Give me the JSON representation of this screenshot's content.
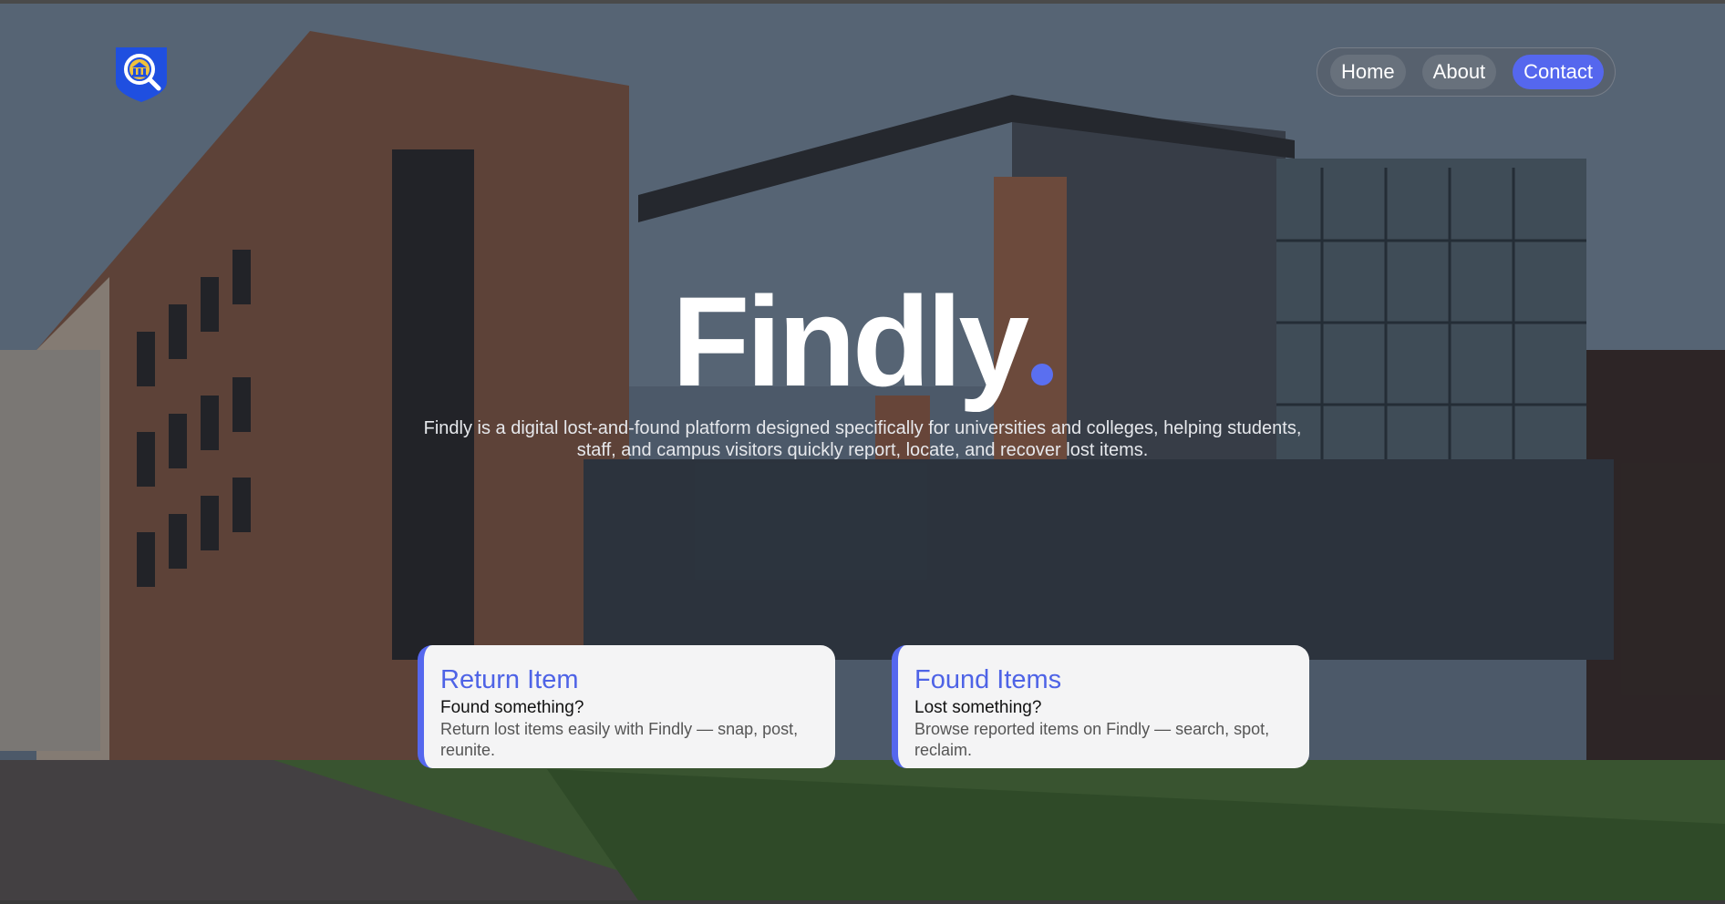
{
  "nav": {
    "items": [
      {
        "label": "Home",
        "active": false
      },
      {
        "label": "About",
        "active": false
      },
      {
        "label": "Contact",
        "active": true
      }
    ]
  },
  "hero": {
    "title": "Findly",
    "description": "Findly is a digital lost-and-found platform designed specifically for universities and colleges, helping students, staff, and campus visitors quickly report, locate, and recover lost items."
  },
  "cards": [
    {
      "title": "Return Item",
      "subtitle": "Found something?",
      "description": "Return lost items easily with Findly — snap, post, reunite."
    },
    {
      "title": "Found Items",
      "subtitle": "Lost something?",
      "description": "Browse reported items on Findly — search, spot, reclaim."
    }
  ],
  "colors": {
    "accent": "#5567ee",
    "card_bg": "#f4f4f5"
  }
}
